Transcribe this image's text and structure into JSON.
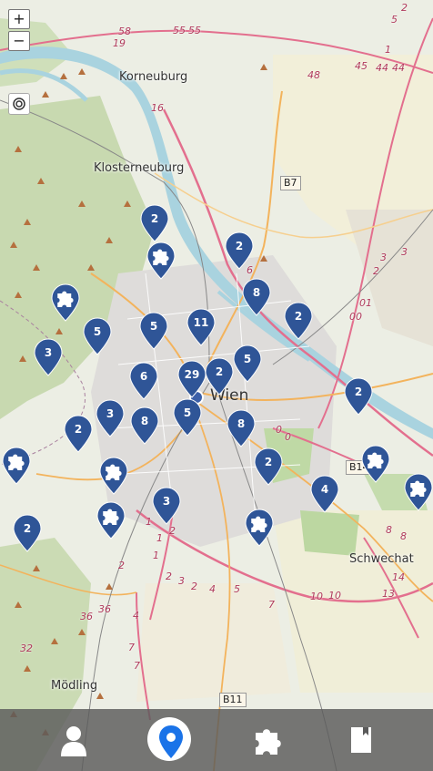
{
  "colors": {
    "marker": "#2f5597",
    "bar": "#5a5a5a",
    "active": "#1a73e8"
  },
  "map": {
    "places": [
      "Korneuburg",
      "Klosterneuburg",
      "Wien",
      "Schwechat",
      "Mödling"
    ],
    "road_shields": [
      "B7",
      "B14",
      "B11"
    ],
    "road_numbers": [
      "58",
      "55",
      "55",
      "48",
      "45",
      "44",
      "44",
      "1",
      "19",
      "16",
      "5",
      "3",
      "2",
      "01",
      "00",
      "6",
      "0",
      "0",
      "8",
      "8",
      "14",
      "13",
      "10",
      "10",
      "7",
      "5",
      "4",
      "3",
      "2",
      "2",
      "1",
      "1",
      "1",
      "2",
      "36",
      "36",
      "4",
      "7",
      "7",
      "32",
      "2",
      "3",
      "2"
    ]
  },
  "markers": [
    "2",
    "2",
    "8",
    "2",
    "5",
    "11",
    "5",
    "3",
    "6",
    "29",
    "2",
    "5",
    "2",
    "3",
    "8",
    "5",
    "8",
    "2",
    "2",
    "4",
    "2",
    "3"
  ],
  "puzzle_markers": 7,
  "controls": {
    "zoom_in": "+",
    "zoom_out": "−"
  },
  "nav": {
    "items": [
      "profile-icon",
      "map-pin-icon",
      "puzzle-icon",
      "bookmark-icon"
    ],
    "active": "map-pin-icon"
  }
}
